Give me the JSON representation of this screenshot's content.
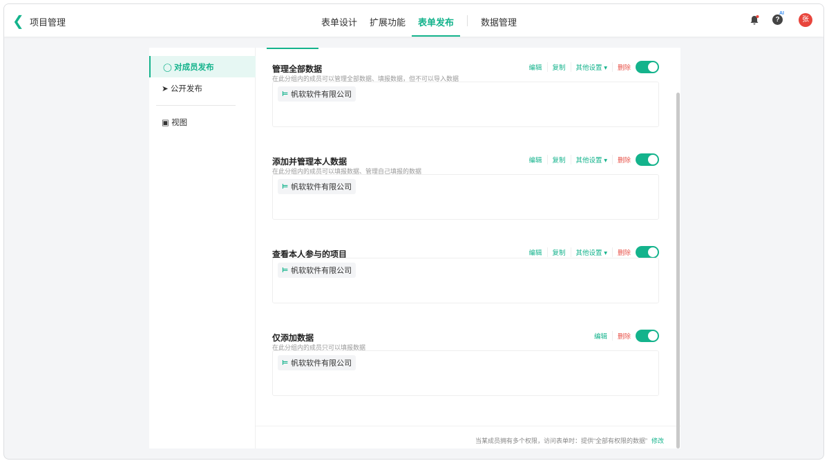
{
  "header": {
    "title": "项目管理",
    "tabs": [
      "表单设计",
      "扩展功能",
      "表单发布",
      "数据管理"
    ],
    "active_tab": "表单发布",
    "ai_badge": "AI",
    "avatar": "张"
  },
  "sidebar": {
    "items": [
      {
        "label": "对成员发布",
        "icon": "member-icon",
        "active": true
      },
      {
        "label": "公开发布",
        "icon": "send-icon"
      },
      {
        "label": "视图",
        "icon": "view-icon"
      }
    ]
  },
  "permissions": [
    {
      "title": "管理全部数据",
      "desc": "在此分组内的成员可以管理全部数据、填报数据，但不可以导入数据",
      "actions": [
        "编辑",
        "复制",
        "其他设置"
      ],
      "delete": "删除",
      "enabled": true,
      "member": "帆软软件有限公司"
    },
    {
      "title": "添加并管理本人数据",
      "desc": "在此分组内的成员可以填报数据、管理自己填报的数据",
      "actions": [
        "编辑",
        "复制",
        "其他设置"
      ],
      "delete": "删除",
      "enabled": true,
      "member": "帆软软件有限公司"
    },
    {
      "title": "查看本人参与的项目",
      "desc": "",
      "actions": [
        "编辑",
        "复制",
        "其他设置"
      ],
      "delete": "删除",
      "enabled": true,
      "member": "帆软软件有限公司"
    },
    {
      "title": "仅添加数据",
      "desc": "在此分组内的成员只可以填报数据",
      "actions": [
        "编辑"
      ],
      "delete": "删除",
      "enabled": true,
      "member": "帆软软件有限公司"
    }
  ],
  "footer": {
    "text": "当某成员拥有多个权限，访问表单时：提供“全部有权限的数据”",
    "link": "修改"
  },
  "colors": {
    "accent": "#14b38c",
    "danger": "#e8534a"
  }
}
